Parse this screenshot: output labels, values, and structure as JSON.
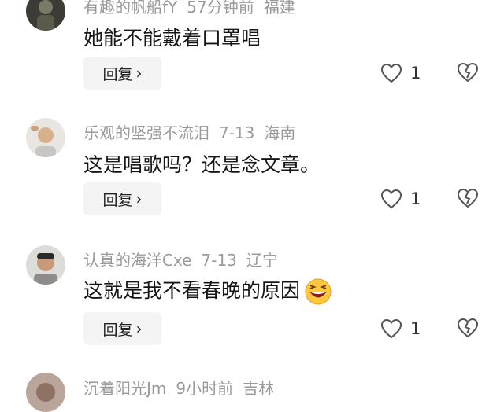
{
  "comments": [
    {
      "username": "有趣的帆船fY",
      "time": "57分钟前",
      "location": "福建",
      "text": "她能不能戴着口罩唱",
      "reply_label": "回复",
      "likes": "1"
    },
    {
      "username": "乐观的坚强不流泪",
      "time": "7-13",
      "location": "海南",
      "text": "这是唱歌吗？还是念文章。",
      "reply_label": "回复",
      "likes": "1"
    },
    {
      "username": "认真的海洋Cxe",
      "time": "7-13",
      "location": "辽宁",
      "text": "这就是我不看春晚的原因",
      "emoji": "laughing-face-emoji",
      "reply_label": "回复",
      "likes": "1"
    },
    {
      "username": "沉着阳光Jm",
      "time": "9小时前",
      "location": "吉林"
    }
  ],
  "icons": {
    "like": "heart-outline-icon",
    "dislike": "broken-heart-icon",
    "chevron": "chevron-right-icon"
  }
}
